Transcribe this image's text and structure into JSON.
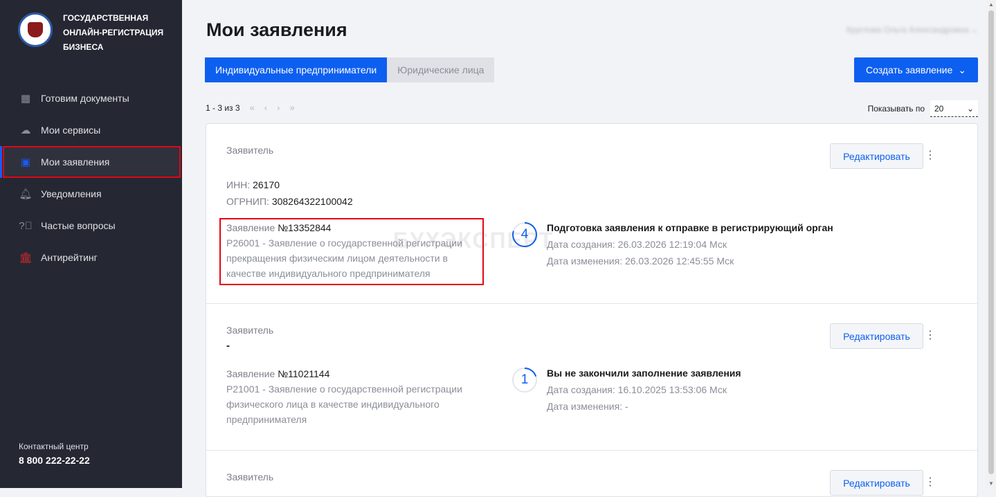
{
  "brand": {
    "line1": "ГОСУДАРСТВЕННАЯ",
    "line2": "ОНЛАЙН-РЕГИСТРАЦИЯ",
    "line3": "БИЗНЕСА"
  },
  "sidebar": {
    "items": [
      {
        "label": "Готовим документы",
        "icon": "grid-icon"
      },
      {
        "label": "Мои сервисы",
        "icon": "cloud-icon"
      },
      {
        "label": "Мои заявления",
        "icon": "document-icon",
        "active": true
      },
      {
        "label": "Уведомления",
        "icon": "bell-icon"
      },
      {
        "label": "Частые вопросы",
        "icon": "question-icon"
      },
      {
        "label": "Антирейтинг",
        "icon": "bank-icon"
      }
    ],
    "contact_label": "Контактный центр",
    "phone": "8 800 222-22-22"
  },
  "header": {
    "title": "Мои заявления",
    "user": "Круглова Ольга Александровна"
  },
  "tabs": [
    {
      "label": "Индивидуальные предприниматели",
      "active": true
    },
    {
      "label": "Юридические лица",
      "active": false
    }
  ],
  "create_button": "Создать заявление",
  "pagination": {
    "range": "1 - 3 из 3",
    "first": "«",
    "prev": "‹",
    "next": "›",
    "last": "»",
    "per_page_label": "Показывать по",
    "per_page": "20"
  },
  "watermark": "БУХЭКСПЕРТ",
  "colors": {
    "accent": "#0d5ff0",
    "sidebar": "#252733",
    "highlight": "#e30613"
  },
  "cards": [
    {
      "applicant_label": "Заявитель",
      "inn_label": "ИНН:",
      "inn": "26170",
      "ogrnip_label": "ОГРНИП:",
      "ogrnip": "308264322100042",
      "edit": "Редактировать",
      "app_label": "Заявление",
      "app_number": "№13352844",
      "app_desc": "Р26001 - Заявление о государственной регистрации прекращения физическим лицом деятельности в качестве индивидуального предпринимателя",
      "step": "4",
      "step_progress": 0.8,
      "status": "Подготовка заявления к отправке в регистрирующий орган",
      "created": "Дата создания: 26.03.2026 12:19:04 Мск",
      "modified": "Дата изменения: 26.03.2026 12:45:55 Мск"
    },
    {
      "applicant_label": "Заявитель",
      "applicant": "-",
      "edit": "Редактировать",
      "app_label": "Заявление",
      "app_number": "№11021144",
      "app_desc": "Р21001 - Заявление о государственной регистрации физического лица в качестве индивидуального предпринимателя",
      "step": "1",
      "step_progress": 0.2,
      "status": "Вы не закончили заполнение заявления",
      "created": "Дата создания: 16.10.2025 13:53:06 Мск",
      "modified": "Дата изменения: -"
    },
    {
      "applicant_label": "Заявитель",
      "edit": "Редактировать"
    }
  ]
}
